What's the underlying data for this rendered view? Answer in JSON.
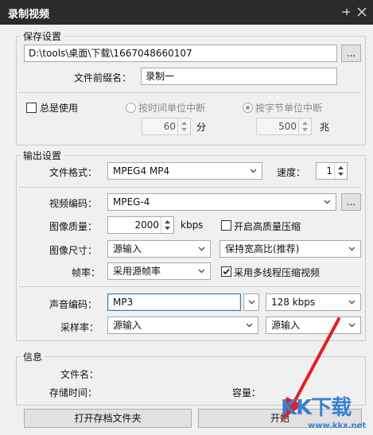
{
  "window": {
    "title": "录制视频"
  },
  "save": {
    "group_label": "保存设置",
    "path_value": "D:\\tools\\桌面\\下载\\1667048660107",
    "browse_label": "...",
    "prefix_label": "文件前缀名：",
    "prefix_value": "录制一",
    "always_use_label": "总是使用",
    "by_time_label": "按时间单位中断",
    "by_time_value": "60",
    "by_time_unit": "分",
    "by_size_label": "按字节单位中断",
    "by_size_value": "500",
    "by_size_unit": "兆"
  },
  "output": {
    "group_label": "输出设置",
    "format_label": "文件格式：",
    "format_value": "MPEG4 MP4",
    "speed_label": "速度：",
    "speed_value": "1",
    "video_codec_label": "视频编码：",
    "video_codec_value": "MPEG-4",
    "video_codec_btn": "...",
    "quality_label": "图像质量：",
    "quality_value": "2000",
    "quality_unit": "kbps",
    "hq_label": "开启高质量压缩",
    "size_label": "图像尺寸：",
    "size_value": "源输入",
    "aspect_value": "保持宽高比(推荐)",
    "fps_label": "帧率：",
    "fps_value": "采用源帧率",
    "multithread_label": "采用多线程压缩视频",
    "audio_codec_label": "声音编码：",
    "audio_codec_value": "MP3",
    "audio_bitrate_value": "128 kbps",
    "sample_rate_label": "采样率：",
    "sample_rate_value": "源输入",
    "channels_value": "源输入"
  },
  "info": {
    "group_label": "信息",
    "filename_label": "文件名：",
    "duration_label": "存储时间：",
    "capacity_label": "容量："
  },
  "buttons": {
    "open_folder": "打开存档文件夹",
    "start": "开始"
  },
  "watermark": {
    "text": "KK下载",
    "url": "www.kkx.net"
  },
  "colors": {
    "titlebar": "#2b2b2b",
    "arrow": "#e02020",
    "watermark": "#3a7fd1"
  }
}
